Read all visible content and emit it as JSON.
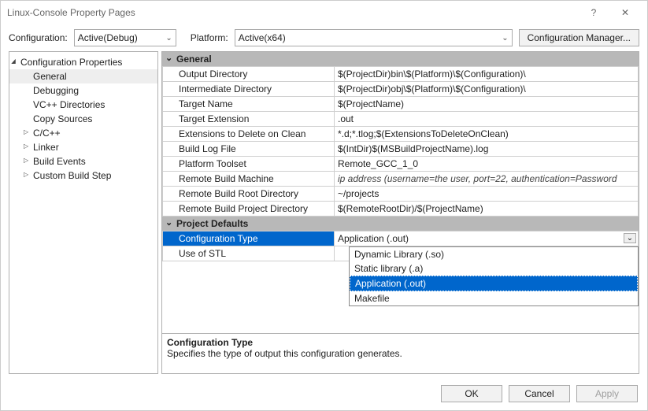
{
  "titlebar": {
    "title": "Linux-Console Property Pages",
    "help": "?",
    "close": "✕"
  },
  "configRow": {
    "configLabel": "Configuration:",
    "configValue": "Active(Debug)",
    "platformLabel": "Platform:",
    "platformValue": "Active(x64)",
    "managerLabel": "Configuration Manager..."
  },
  "tree": {
    "root": "Configuration Properties",
    "items": [
      "General",
      "Debugging",
      "VC++ Directories",
      "Copy Sources",
      "C/C++",
      "Linker",
      "Build Events",
      "Custom Build Step"
    ]
  },
  "sections": {
    "general": "General",
    "defaults": "Project Defaults"
  },
  "props": {
    "general": [
      {
        "k": "Output Directory",
        "v": "$(ProjectDir)bin\\$(Platform)\\$(Configuration)\\"
      },
      {
        "k": "Intermediate Directory",
        "v": "$(ProjectDir)obj\\$(Platform)\\$(Configuration)\\"
      },
      {
        "k": "Target Name",
        "v": "$(ProjectName)"
      },
      {
        "k": "Target Extension",
        "v": ".out"
      },
      {
        "k": "Extensions to Delete on Clean",
        "v": "*.d;*.tlog;$(ExtensionsToDeleteOnClean)"
      },
      {
        "k": "Build Log File",
        "v": "$(IntDir)$(MSBuildProjectName).log"
      },
      {
        "k": "Platform Toolset",
        "v": "Remote_GCC_1_0"
      },
      {
        "k": "Remote Build Machine",
        "v": "ip address    (username=the user, port=22, authentication=Password",
        "italic": true
      },
      {
        "k": "Remote Build Root Directory",
        "v": "~/projects"
      },
      {
        "k": "Remote Build Project Directory",
        "v": "$(RemoteRootDir)/$(ProjectName)"
      }
    ],
    "defaults": [
      {
        "k": "Configuration Type",
        "v": "Application (.out)",
        "sel": true
      },
      {
        "k": "Use of STL",
        "v": ""
      }
    ]
  },
  "dropdown": {
    "options": [
      "Dynamic Library (.so)",
      "Static library (.a)",
      "Application (.out)",
      "Makefile"
    ],
    "selectedIndex": 2
  },
  "desc": {
    "title": "Configuration Type",
    "text": "Specifies the type of output this configuration generates."
  },
  "footer": {
    "ok": "OK",
    "cancel": "Cancel",
    "apply": "Apply"
  }
}
